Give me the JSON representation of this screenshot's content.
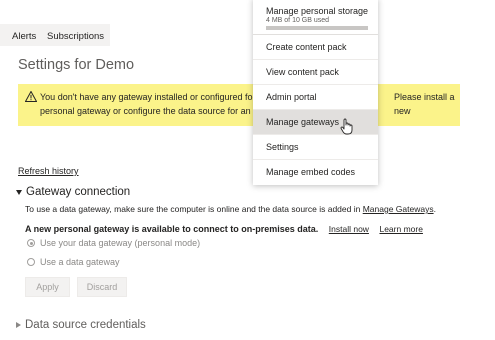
{
  "tabs": [
    {
      "label": "Alerts"
    },
    {
      "label": "Subscriptions"
    }
  ],
  "page_title": "Settings for Demo",
  "warning": {
    "text": "You don't have any gateway installed or configured for t",
    "text_line2": "personal gateway or configure the data source for an ex",
    "text_right": "Please install a new",
    "icon": "warning-icon",
    "color": "#fbf38a"
  },
  "refresh_history": "Refresh history",
  "gateway_section": {
    "title": "Gateway connection",
    "description": "To use a data gateway, make sure the computer is online and the data source is added in",
    "manage_link": "Manage Gateways",
    "desc_end": ".",
    "promo_text": "A new personal gateway is available to connect to on-premises data.",
    "install_now": "Install now",
    "learn_more": "Learn more",
    "option_personal": "Use your data gateway (personal mode)",
    "option_data": "Use a data gateway",
    "apply_label": "Apply",
    "discard_label": "Discard"
  },
  "datasource_section": {
    "title": "Data source credentials"
  },
  "menu": {
    "storage_label": "Manage personal storage",
    "storage_used": "4 MB of 10 GB used",
    "storage_fraction": 0.0004,
    "items": [
      {
        "label": "Create content pack"
      },
      {
        "label": "View content pack"
      },
      {
        "label": "Admin portal"
      },
      {
        "label": "Manage gateways"
      },
      {
        "label": "Settings"
      },
      {
        "label": "Manage embed codes"
      }
    ]
  },
  "colors": {
    "warning_bg": "#fbf38a",
    "menu_hover": "#e1dfdd"
  }
}
